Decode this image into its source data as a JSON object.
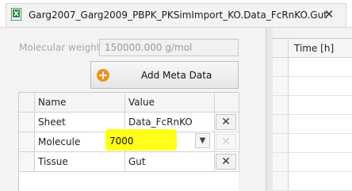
{
  "tab": {
    "title": "Garg2007_Garg2009_PBPK_PKSimImport_KO.Data_FcRnKO.Gut",
    "close_glyph": "✕",
    "icon": "excel-file-icon"
  },
  "molecular_weight": {
    "label": "Molecular weight:",
    "value": "150000.000 g/mol"
  },
  "add_meta_button": {
    "label": "Add Meta Data",
    "icon": "add-circle-icon",
    "icon_glyph": "+"
  },
  "meta_table": {
    "columns": [
      "Name",
      "Value"
    ],
    "rows": [
      {
        "name": "Sheet",
        "value": "Data_FcRnKO",
        "editor": "text",
        "delete_enabled": true
      },
      {
        "name": "Molecule",
        "value": "7000",
        "editor": "combo",
        "delete_enabled": false
      },
      {
        "name": "Tissue",
        "value": "Gut",
        "editor": "text",
        "delete_enabled": true
      }
    ],
    "delete_glyph": "✕",
    "dropdown_glyph": "▼"
  },
  "data_grid": {
    "columns": [
      "Time [h]"
    ]
  },
  "colors": {
    "highlight": "#ffff1a",
    "add_icon": "#f0901b"
  }
}
